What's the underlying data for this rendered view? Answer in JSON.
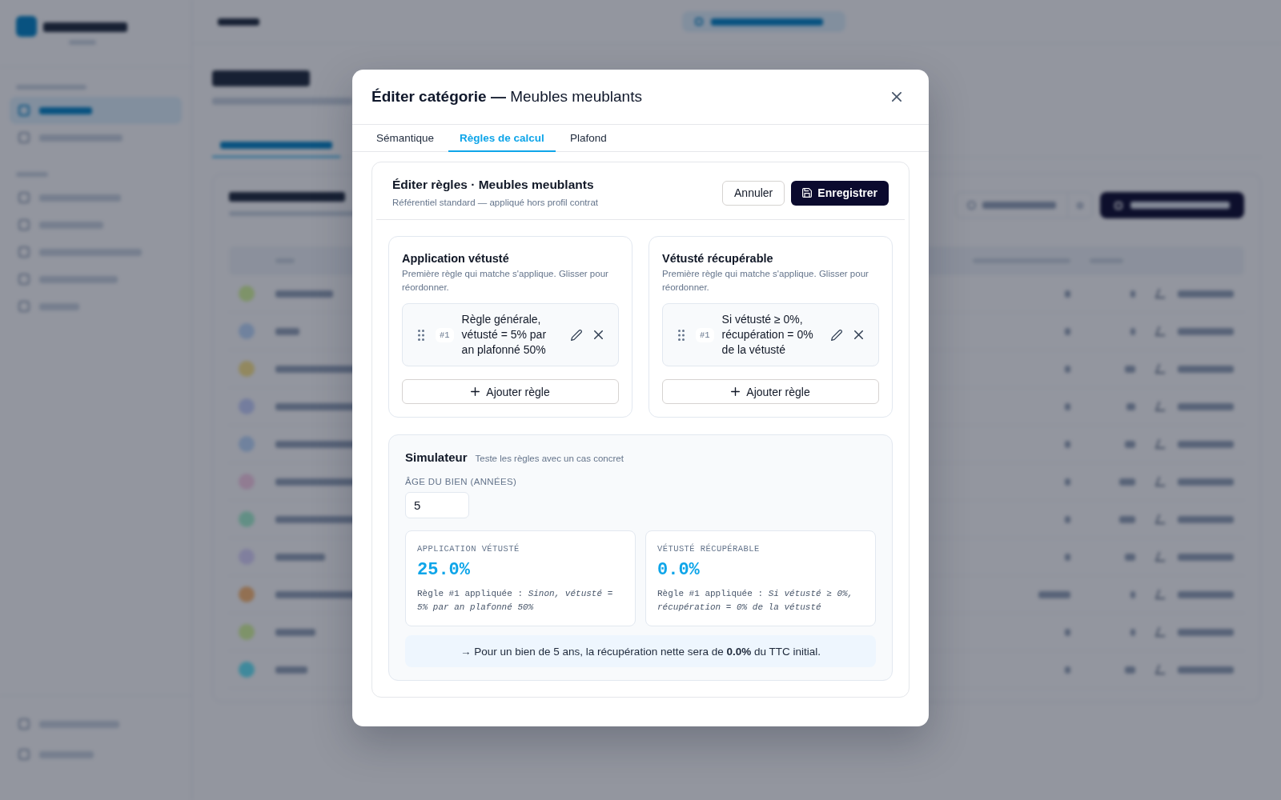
{
  "modal": {
    "title": "**Éditer catégorie —** Meubles meublants",
    "tabs": [
      {
        "label": "Sémantique",
        "selected": false
      },
      {
        "label": "Règles de calcul",
        "selected": true
      },
      {
        "label": "Plafond",
        "selected": false
      }
    ],
    "editor": {
      "title": "Éditer règles · Meubles meublants",
      "subtitle": "Référentiel standard — appliqué hors profil contrat",
      "cancel_button": "Annuler",
      "save_button": "Enregistrer",
      "rule_groups": [
        {
          "title": "Application vétusté",
          "description": "Première règle qui matche s'applique. Glisser pour réordonner.",
          "rules": [
            {
              "number": "#1",
              "text": "Règle générale, vétusté = 5% par an plafonné 50%"
            }
          ],
          "add_button": "Ajouter règle"
        },
        {
          "title": "Vétusté récupérable",
          "description": "Première règle qui matche s'applique. Glisser pour réordonner.",
          "rules": [
            {
              "number": "#1",
              "text": "Si vétusté ≥ 0%, récupération = 0% de la vétusté"
            }
          ],
          "add_button": "Ajouter règle"
        }
      ],
      "simulator": {
        "title": "Simulateur",
        "subtitle": "Teste les règles avec un cas concret",
        "age_label": "ÂGE DU BIEN (ANNÉES)",
        "age_value": "5",
        "results": [
          {
            "label": "APPLICATION VÉTUSTÉ",
            "value": "25.0%",
            "detail": "Règle #1 appliquée : *Sinon, vétusté = 5% par an plafonné 50%*"
          },
          {
            "label": "VÉTUSTÉ RÉCUPÉRABLE",
            "value": "0.0%",
            "detail": "Règle #1 appliquée : *Si vétusté ≥ 0%, récupération = 0% de la vétusté*"
          }
        ],
        "summary": "→ Pour un bien de 5 ans, la récupération nette sera de **0.0%** du TTC initial."
      }
    }
  }
}
